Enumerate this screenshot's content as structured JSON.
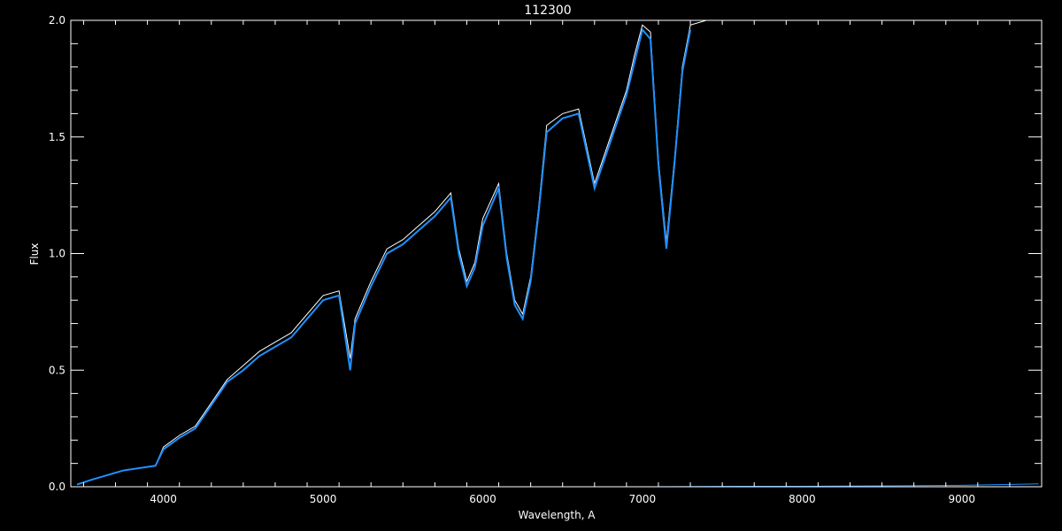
{
  "chart_data": {
    "type": "line",
    "title": "112300",
    "xlabel": "Wavelength, A",
    "ylabel": "Flux",
    "xlim": [
      3420,
      9500
    ],
    "ylim": [
      0,
      2.0
    ],
    "x_ticks": [
      4000,
      5000,
      6000,
      7000,
      8000,
      9000
    ],
    "x_tick_labels": [
      "4000",
      "5000",
      "6000",
      "7000",
      "8000",
      "9000"
    ],
    "y_ticks": [
      0.0,
      0.5,
      1.0,
      1.5,
      2.0
    ],
    "y_tick_labels": [
      "0.0",
      "0.5",
      "1.0",
      "1.5",
      "2.0"
    ],
    "grid": false,
    "background_color": "#000000",
    "axis_color": "#ffffff",
    "series": [
      {
        "color": "#ffffff",
        "x": [
          3460,
          3550,
          3650,
          3750,
          3850,
          3950,
          4000,
          4100,
          4200,
          4300,
          4400,
          4500,
          4600,
          4700,
          4800,
          4900,
          5000,
          5100,
          5170,
          5200,
          5300,
          5400,
          5500,
          5600,
          5700,
          5800,
          5850,
          5900,
          5950,
          6000,
          6100,
          6150,
          6200,
          6250,
          6300,
          6350,
          6400,
          6500,
          6600,
          6700,
          6800,
          6900,
          6950,
          7000,
          7050,
          7100,
          7150,
          7200,
          7250,
          7300,
          7400,
          7600,
          7700,
          7800,
          8000,
          8200,
          8400,
          8600,
          8800,
          9000,
          9200,
          9480
        ],
        "values": [
          0.01,
          0.03,
          0.05,
          0.07,
          0.08,
          0.09,
          0.17,
          0.22,
          0.26,
          0.36,
          0.46,
          0.52,
          0.58,
          0.62,
          0.66,
          0.74,
          0.82,
          0.84,
          0.55,
          0.72,
          0.88,
          1.02,
          1.06,
          1.12,
          1.18,
          1.26,
          1.02,
          0.88,
          0.96,
          1.15,
          1.3,
          1.0,
          0.8,
          0.74,
          0.9,
          1.2,
          1.55,
          1.6,
          1.62,
          1.3,
          1.5,
          1.7,
          1.85,
          1.98,
          1.95,
          1.4,
          1.05,
          1.4,
          1.8,
          1.98,
          2.0,
          2.0,
          2.0,
          2.0,
          2.0,
          2.0,
          2.0,
          2.0,
          2.0,
          2.0,
          2.0,
          2.0
        ]
      },
      {
        "color": "#1e90ff",
        "x": [
          3460,
          3550,
          3650,
          3750,
          3850,
          3950,
          4000,
          4100,
          4200,
          4300,
          4400,
          4500,
          4600,
          4700,
          4800,
          4900,
          5000,
          5100,
          5170,
          5200,
          5300,
          5400,
          5500,
          5600,
          5700,
          5800,
          5850,
          5900,
          5950,
          6000,
          6100,
          6150,
          6200,
          6250,
          6300,
          6350,
          6400,
          6500,
          6600,
          6700,
          6800,
          6900,
          6950,
          7000,
          7050,
          7100,
          7150,
          7200,
          7250,
          7300
        ],
        "values": [
          0.01,
          0.03,
          0.05,
          0.07,
          0.08,
          0.09,
          0.16,
          0.21,
          0.25,
          0.35,
          0.45,
          0.5,
          0.56,
          0.6,
          0.64,
          0.72,
          0.8,
          0.82,
          0.5,
          0.7,
          0.86,
          1.0,
          1.04,
          1.1,
          1.16,
          1.24,
          1.0,
          0.86,
          0.94,
          1.12,
          1.28,
          0.98,
          0.78,
          0.72,
          0.88,
          1.18,
          1.52,
          1.58,
          1.6,
          1.28,
          1.48,
          1.68,
          1.82,
          1.96,
          1.92,
          1.38,
          1.02,
          1.38,
          1.78,
          1.96
        ]
      },
      {
        "color": "#1e90ff",
        "x": [
          4000,
          5000,
          6000,
          7000,
          7600,
          8000,
          8200,
          8600,
          9000,
          9300,
          9480
        ],
        "values": [
          0.0,
          0.0,
          0.0,
          0.0,
          0.002,
          0.002,
          0.003,
          0.004,
          0.006,
          0.01,
          0.012
        ]
      }
    ]
  }
}
